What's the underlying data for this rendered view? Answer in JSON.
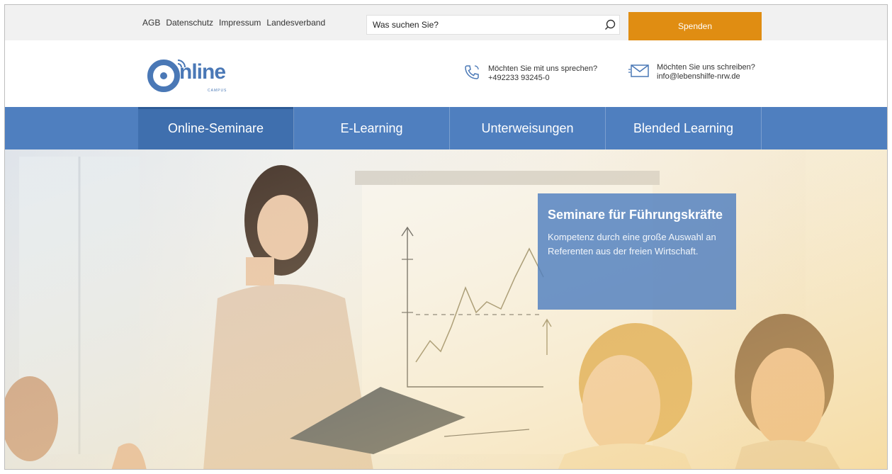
{
  "topbar": {
    "links": [
      "AGB",
      "Datenschutz",
      "Impressum",
      "Landesverband"
    ],
    "search_placeholder": "Was suchen Sie?",
    "donate_label": "Spenden"
  },
  "header": {
    "logo_text": "nline",
    "logo_sub": "CAMPUS",
    "phone": {
      "title": "Möchten Sie mit uns sprechen?",
      "value": "+492233 93245-0"
    },
    "mail": {
      "title": "Möchten Sie uns schreiben?",
      "value": "info@lebenshilfe-nrw.de"
    }
  },
  "nav": {
    "items": [
      {
        "label": "Online-Seminare",
        "active": true
      },
      {
        "label": "E-Learning",
        "active": false
      },
      {
        "label": "Unterweisungen",
        "active": false
      },
      {
        "label": "Blended Learning",
        "active": false
      }
    ]
  },
  "hero": {
    "title": "Seminare für Führungskräfte",
    "text": "Kompetenz durch eine große Auswahl an Referenten aus der freien Wirtschaft."
  },
  "colors": {
    "accent_orange": "#e08d12",
    "brand_blue": "#4f7fbf",
    "active_blue": "#3f6fae"
  }
}
